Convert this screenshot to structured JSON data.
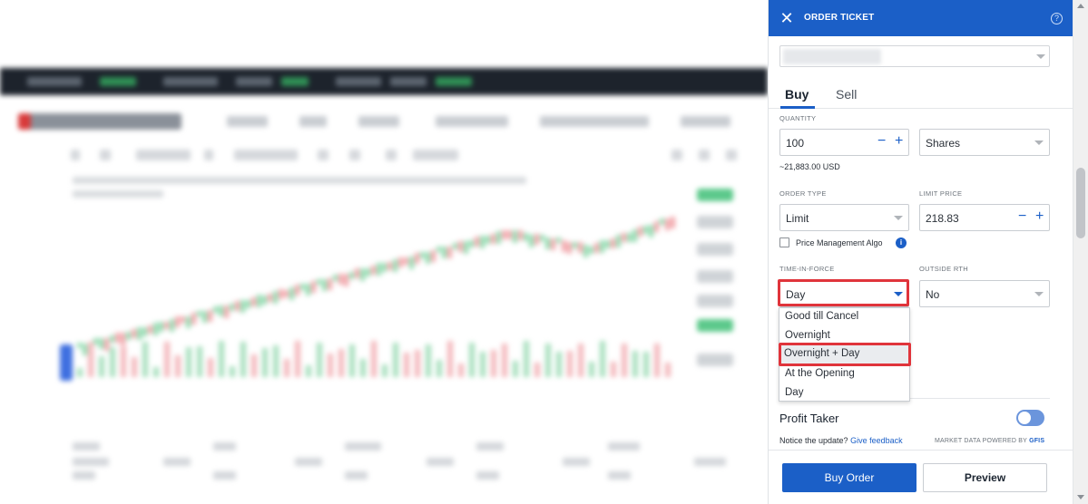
{
  "order_ticket": {
    "title": "ORDER TICKET",
    "close_icon": "close-icon",
    "help_icon": "help-icon",
    "help_glyph": "?",
    "symbol_selector": {
      "value": ""
    },
    "tabs": [
      {
        "label": "Buy",
        "selected": true
      },
      {
        "label": "Sell",
        "selected": false
      }
    ],
    "quantity": {
      "label": "QUANTITY",
      "value": "100",
      "unit": "Shares",
      "estimate": "~21,883.00 USD",
      "minus": "−",
      "plus": "+"
    },
    "order_type": {
      "label": "ORDER TYPE",
      "value": "Limit"
    },
    "limit_price": {
      "label": "LIMIT PRICE",
      "value": "218.83",
      "minus": "−",
      "plus": "+"
    },
    "price_management": {
      "label": "Price Management Algo",
      "checked": false,
      "info_glyph": "i"
    },
    "time_in_force": {
      "label": "TIME-IN-FORCE",
      "value": "Day",
      "options": [
        "Good till Cancel",
        "Overnight",
        "Overnight + Day",
        "At the Opening",
        "Day"
      ],
      "highlighted_option": "Overnight + Day"
    },
    "outside_rth": {
      "label": "OUTSIDE RTH",
      "value": "No"
    },
    "profit_taker": {
      "label": "Profit Taker",
      "enabled": false
    },
    "notice": {
      "text": "Notice the update?",
      "link": "Give feedback"
    },
    "market_data": {
      "text": "MARKET DATA POWERED BY",
      "provider": "GFIS"
    },
    "buttons": {
      "buy_order": "Buy Order",
      "preview": "Preview"
    }
  },
  "colors": {
    "accent": "#1b5fc7",
    "highlight_border": "#e0343b",
    "header_bg": "#1b5fc7"
  }
}
